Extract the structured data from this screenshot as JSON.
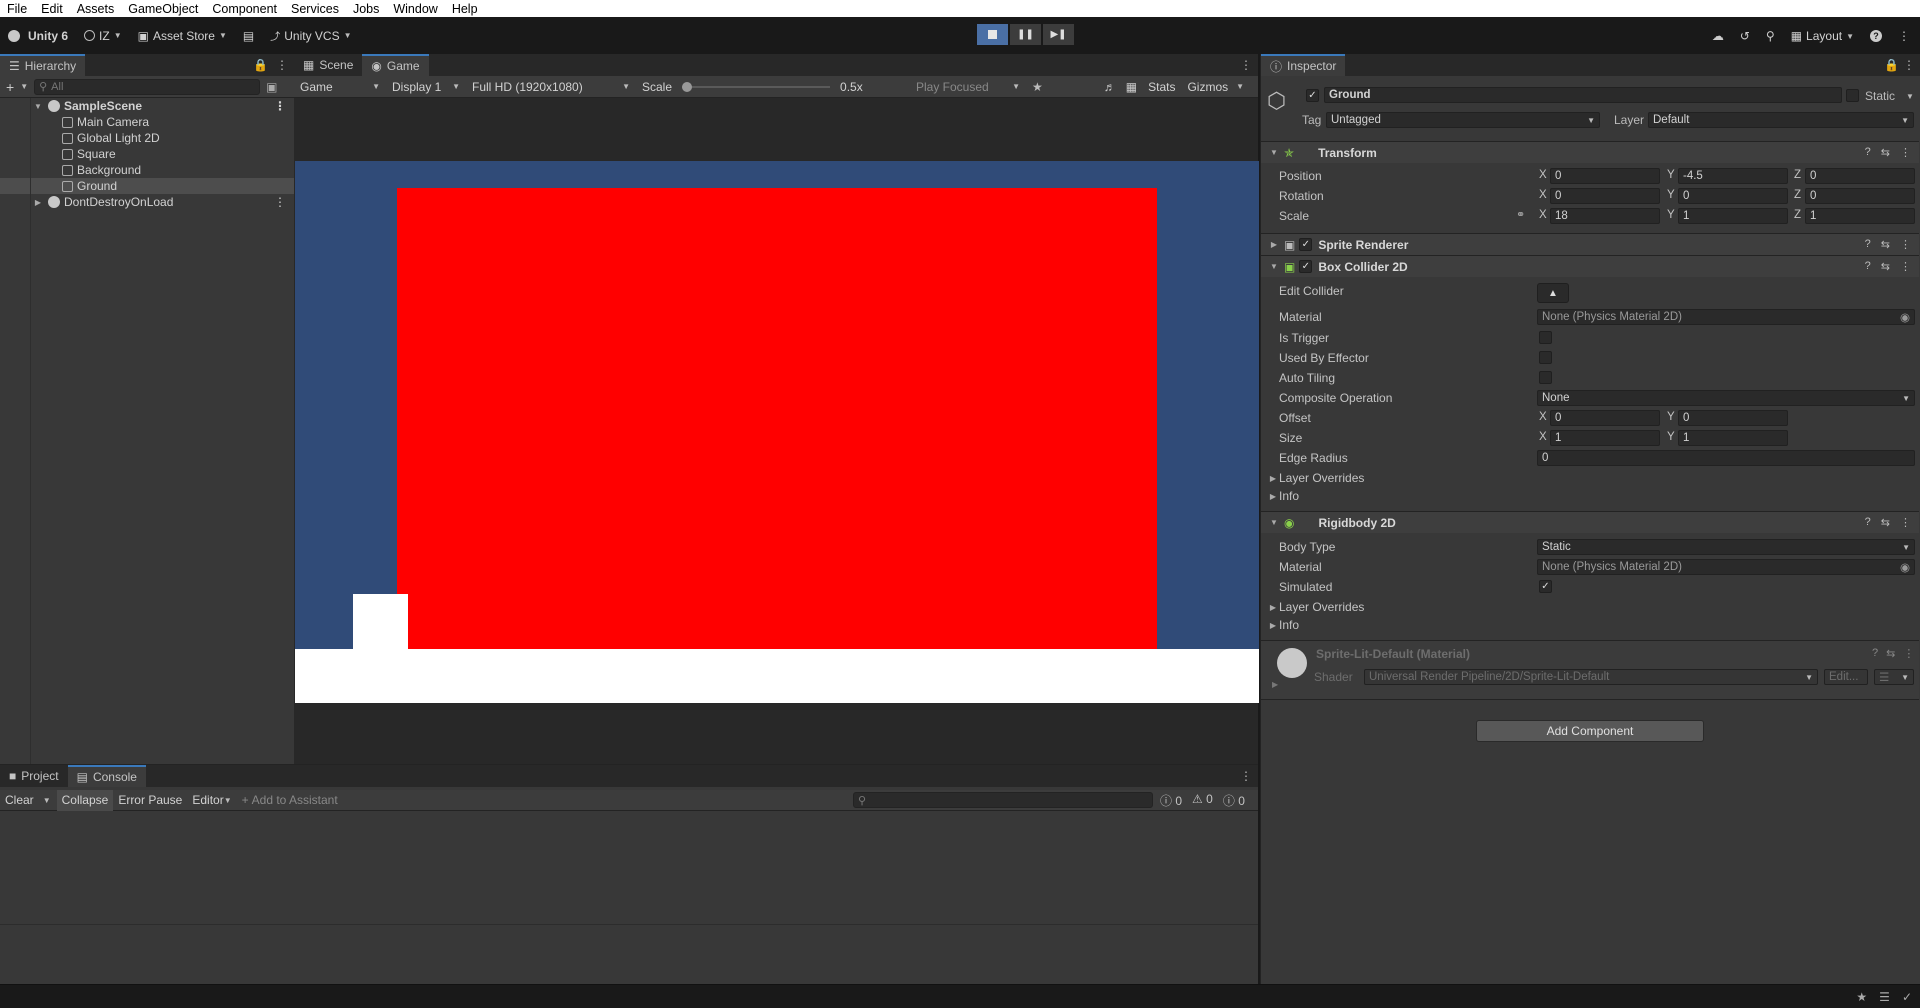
{
  "menu": [
    "File",
    "Edit",
    "Assets",
    "GameObject",
    "Component",
    "Services",
    "Jobs",
    "Window",
    "Help"
  ],
  "toolbar": {
    "unity_label": "Unity 6",
    "account_label": "IZ",
    "asset_store_label": "Asset Store",
    "vcs_label": "Unity VCS",
    "layout_label": "Layout"
  },
  "hierarchy": {
    "tab_label": "Hierarchy",
    "search_placeholder": "All",
    "scene": "SampleScene",
    "items": [
      "Main Camera",
      "Global Light 2D",
      "Square",
      "Background",
      "Ground"
    ],
    "selected": "Ground",
    "ddol": "DontDestroyOnLoad"
  },
  "gameview": {
    "tabs": [
      "Scene",
      "Game"
    ],
    "active_tab": "Game",
    "game_select": "Game",
    "display": "Display 1",
    "resolution": "Full HD (1920x1080)",
    "scale_label": "Scale",
    "scale_value": "0.5x",
    "play_focused": "Play Focused",
    "stats": "Stats",
    "gizmos": "Gizmos",
    "colors": {
      "sky": "#304b78",
      "ground": "#ff0000",
      "floor": "#ffffff",
      "player": "#ffffff"
    }
  },
  "console": {
    "tabs": [
      "Project",
      "Console"
    ],
    "active_tab": "Console",
    "clear": "Clear",
    "collapse": "Collapse",
    "error_pause": "Error Pause",
    "editor": "Editor",
    "add_assistant": "Add to Assistant",
    "counts": [
      "0",
      "0",
      "0"
    ]
  },
  "inspector": {
    "tab_label": "Inspector",
    "object_name": "Ground",
    "static_label": "Static",
    "tag_label": "Tag",
    "tag_value": "Untagged",
    "layer_label": "Layer",
    "layer_value": "Default",
    "transform": {
      "title": "Transform",
      "position_label": "Position",
      "position": [
        "0",
        "-4.5",
        "0"
      ],
      "rotation_label": "Rotation",
      "rotation": [
        "0",
        "0",
        "0"
      ],
      "scale_label": "Scale",
      "scale": [
        "18",
        "1",
        "1"
      ]
    },
    "sprite_renderer": {
      "title": "Sprite Renderer"
    },
    "box_collider": {
      "title": "Box Collider 2D",
      "edit_collider": "Edit Collider",
      "material_label": "Material",
      "material_value": "None (Physics Material 2D)",
      "is_trigger": "Is Trigger",
      "used_by_effector": "Used By Effector",
      "auto_tiling": "Auto Tiling",
      "composite_label": "Composite Operation",
      "composite_value": "None",
      "offset_label": "Offset",
      "offset": [
        "0",
        "0"
      ],
      "size_label": "Size",
      "size": [
        "1",
        "1"
      ],
      "edge_radius_label": "Edge Radius",
      "edge_radius": "0",
      "layer_overrides": "Layer Overrides",
      "info": "Info"
    },
    "rigidbody": {
      "title": "Rigidbody 2D",
      "body_type_label": "Body Type",
      "body_type": "Static",
      "material_label": "Material",
      "material_value": "None (Physics Material 2D)",
      "simulated_label": "Simulated",
      "layer_overrides": "Layer Overrides",
      "info": "Info"
    },
    "material": {
      "name": "Sprite-Lit-Default (Material)",
      "shader_label": "Shader",
      "shader_value": "Universal Render Pipeline/2D/Sprite-Lit-Default",
      "edit_label": "Edit..."
    },
    "add_component": "Add Component"
  },
  "axis_labels": {
    "x": "X",
    "y": "Y",
    "z": "Z"
  }
}
